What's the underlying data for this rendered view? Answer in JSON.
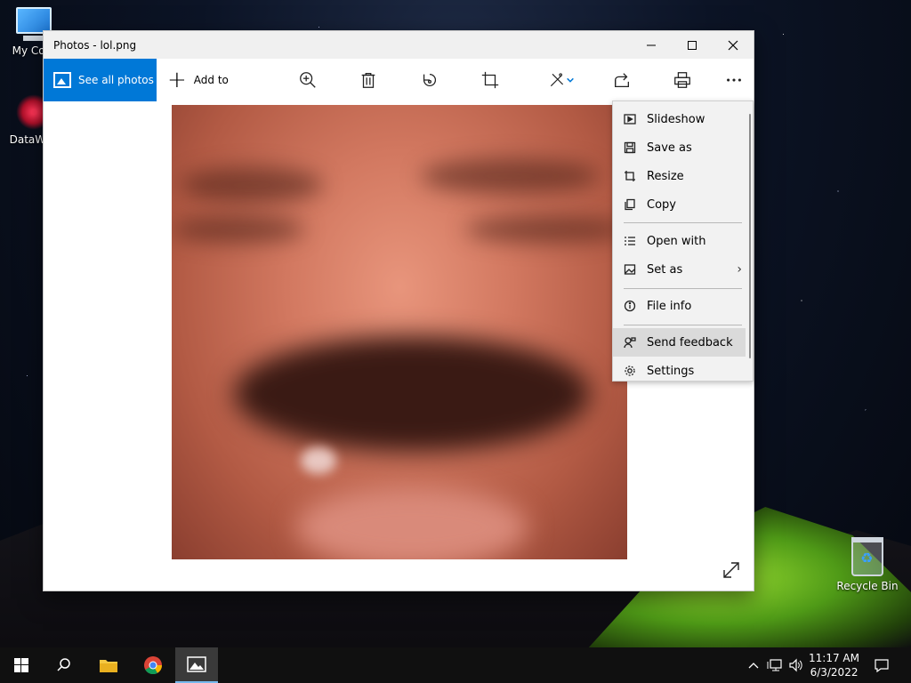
{
  "desktop": {
    "icons": [
      {
        "label": "My Com"
      },
      {
        "label": "DataWag"
      },
      {
        "label": "Recycle Bin"
      }
    ]
  },
  "window": {
    "title": "Photos - lol.png",
    "toolbar": {
      "see_all_photos": "See all photos",
      "add_to": "Add to"
    }
  },
  "context_menu": {
    "items": [
      {
        "label": "Slideshow",
        "icon": "slideshow-icon"
      },
      {
        "label": "Save as",
        "icon": "save-icon"
      },
      {
        "label": "Resize",
        "icon": "resize-icon"
      },
      {
        "label": "Copy",
        "icon": "copy-icon"
      },
      {
        "label": "Open with",
        "icon": "open-with-icon"
      },
      {
        "label": "Set as",
        "icon": "set-as-icon"
      },
      {
        "label": "File info",
        "icon": "info-icon"
      },
      {
        "label": "Send feedback",
        "icon": "feedback-icon"
      },
      {
        "label": "Settings",
        "icon": "gear-icon"
      }
    ],
    "hovered": "Send feedback"
  },
  "taskbar": {
    "time": "11:17 AM",
    "date": "6/3/2022"
  },
  "colors": {
    "accent": "#0078d7",
    "menu_bg": "#f2f2f2",
    "taskbar_bg": "#101010"
  }
}
